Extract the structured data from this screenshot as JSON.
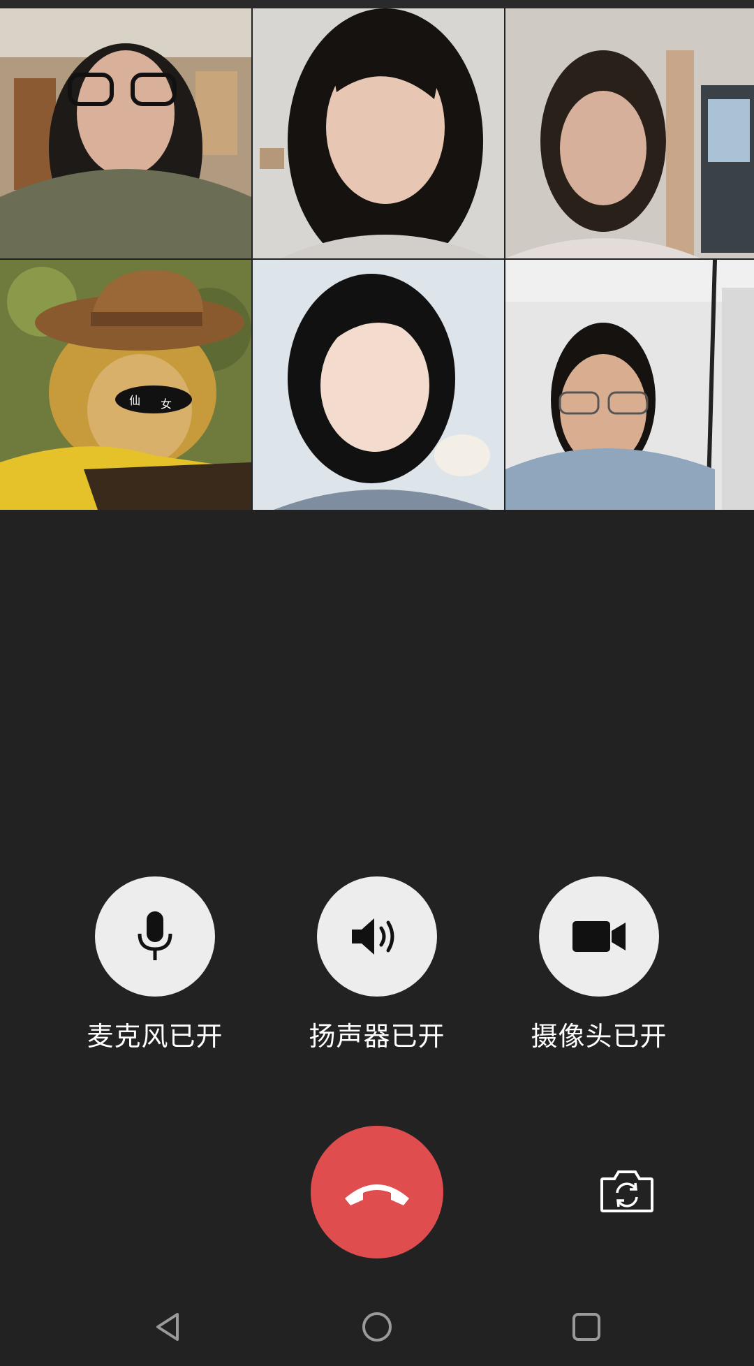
{
  "participants": [
    {
      "name": "participant-1",
      "bg": "#b09a80",
      "shirt": "#6b6d55",
      "hair": "#1e1a18",
      "skin": "#d9b09a"
    },
    {
      "name": "participant-2",
      "bg": "#d8d6d2",
      "shirt": "#d2cfcb",
      "hair": "#15120f",
      "skin": "#e7c6b3"
    },
    {
      "name": "participant-3",
      "bg": "#cfcac4",
      "shirt": "#e4dcd9",
      "hair": "#2a201a",
      "skin": "#d6b09a"
    },
    {
      "name": "participant-4",
      "bg": "#6f7a3d",
      "shirt": "#e5c12a",
      "hair": "#c79a3b",
      "skin": "#d8b06a"
    },
    {
      "name": "participant-5",
      "bg": "#dde5ea",
      "shirt": "#7f8da0",
      "hair": "#111111",
      "skin": "#f3dccd"
    },
    {
      "name": "participant-6",
      "bg": "#e6e6e6",
      "shirt": "#8fa6bd",
      "hair": "#151210",
      "skin": "#d9ad90"
    }
  ],
  "sticker_text": [
    "仙",
    "女"
  ],
  "controls": {
    "mic_label": "麦克风已开",
    "speaker_label": "扬声器已开",
    "camera_label": "摄像头已开"
  },
  "icons": {
    "mic": "microphone-icon",
    "speaker": "speaker-icon",
    "camera": "video-camera-icon",
    "hangup": "hang-up-icon",
    "flip": "switch-camera-icon",
    "back": "back-icon",
    "home": "home-icon",
    "recents": "recents-icon"
  },
  "colors": {
    "background": "#222222",
    "control_circle": "#ededed",
    "hangup": "#e04d4f"
  }
}
